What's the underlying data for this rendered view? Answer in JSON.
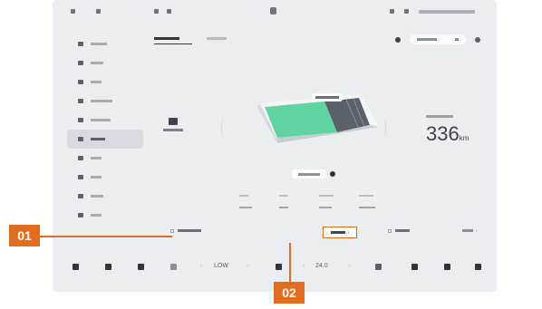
{
  "callouts": {
    "one": "01",
    "two": "02"
  },
  "dock": {
    "fan_level": "LOW",
    "temperature": "24.0"
  },
  "range": {
    "value": "336",
    "unit": "km"
  },
  "colors": {
    "accent": "#e36d1c",
    "battery_green": "#5fd4a0",
    "screen_bg": "#ecedf0"
  },
  "icons": [
    "home-icon",
    "car-icon",
    "seat-icon",
    "climate-icon",
    "ac-icon",
    "music-icon",
    "apps-icon",
    "volume-icon"
  ]
}
